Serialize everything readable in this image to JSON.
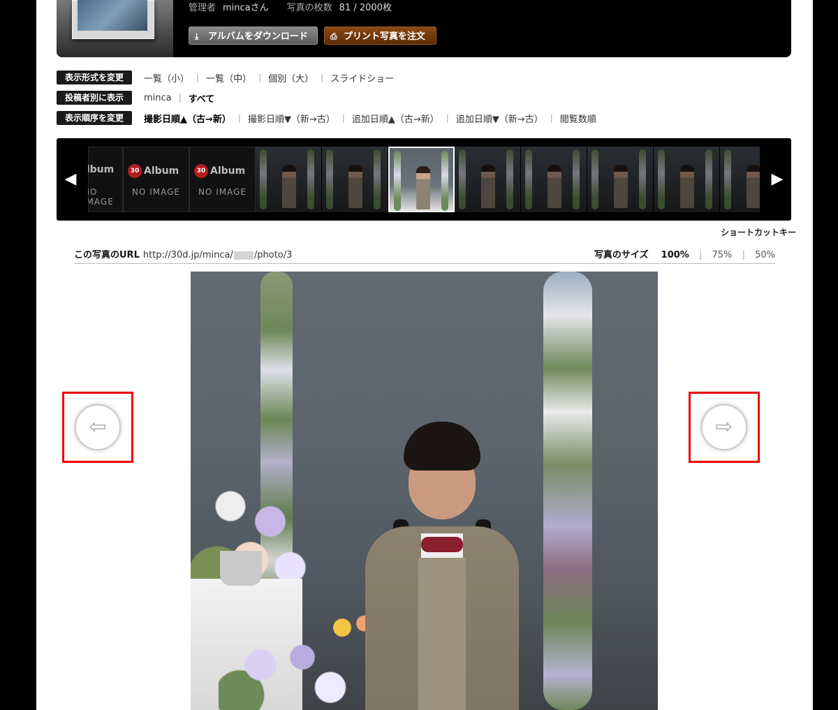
{
  "header": {
    "manager_label": "管理者",
    "manager_name": "mincaさん",
    "photo_count_label": "写真の枚数",
    "photo_count": "81 / 2000枚",
    "download_label": "アルバムをダウンロード",
    "download_icon": "download-icon",
    "print_label": "プリント写真を注文",
    "print_icon": "print-icon"
  },
  "options": {
    "display": {
      "label": "表示形式を変更",
      "items": [
        "一覧（小）",
        "一覧（中）",
        "個別（大）",
        "スライドショー"
      ]
    },
    "poster": {
      "label": "投稿者別に表示",
      "items": [
        "minca",
        "すべて"
      ]
    },
    "order": {
      "label": "表示順序を変更",
      "items": [
        "撮影日順▲（古→新）",
        "撮影日順▼（新→古）",
        "追加日順▲（古→新）",
        "追加日順▼（新→古）",
        "閲覧数順"
      ]
    }
  },
  "filmstrip": {
    "noimage_logo": "Album",
    "noimage_badge": "30",
    "noimage_text": "NO IMAGE",
    "prev_icon": "chevron-left-icon",
    "next_icon": "chevron-right-icon"
  },
  "shortcut_label": "ショートカットキー",
  "photo_url": {
    "label": "この写真のURL",
    "prefix": "http://30d.jp/minca/",
    "suffix": "/photo/3"
  },
  "size": {
    "label": "写真のサイズ",
    "options": [
      "100%",
      "75%",
      "50%"
    ],
    "selected": "100%"
  },
  "nav": {
    "prev_icon": "arrow-left-circle-icon",
    "next_icon": "arrow-right-circle-icon"
  },
  "colors": {
    "highlight_box": "#ee0000",
    "print_button": "#7a3a0c",
    "download_button": "#6e6e6e"
  }
}
